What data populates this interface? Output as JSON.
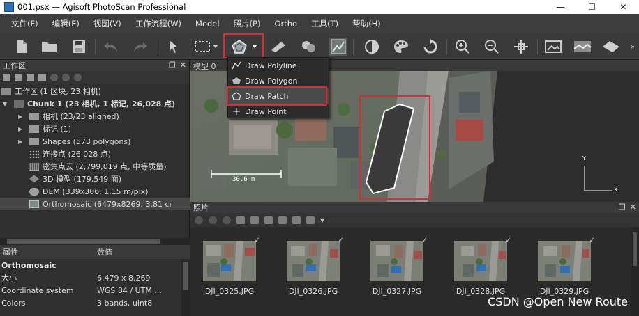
{
  "window": {
    "title": "001.psx — Agisoft PhotoScan Professional",
    "controls": [
      "—",
      "☐",
      "✕"
    ]
  },
  "menu": [
    "文件(F)",
    "编辑(E)",
    "视图(V)",
    "工作流程(W)",
    "Model",
    "照片(P)",
    "Ortho",
    "工具(T)",
    "帮助(H)"
  ],
  "toolbar": {
    "overflow": "»"
  },
  "workspace": {
    "title": "工作区",
    "root": "工作区 (1 区块, 23 相机)",
    "chunk": "Chunk 1 (23 相机, 1 标记, 26,028 点)",
    "items": [
      "相机 (23/23 aligned)",
      "标记 (1)",
      "Shapes (573 polygons)",
      "连接点 (26,028 点)",
      "密集点云 (2,799,019 点, 中等质量)",
      "3D 模型 (179,549 面)",
      "DEM (339x306, 1.15 m/pix)",
      "Orthomosaic (6479x8269, 3.81 cr"
    ]
  },
  "properties": {
    "col_key": "属性",
    "col_value": "数值",
    "section": "Orthomosaic",
    "rows": [
      {
        "k": "大小",
        "v": "6,479 x 8,269"
      },
      {
        "k": "Coordinate system",
        "v": "WGS 84 / UTM ..."
      },
      {
        "k": "Colors",
        "v": "3 bands, uint8"
      }
    ]
  },
  "model_view": {
    "tab": "模型",
    "tab_suffix": "0",
    "scale_label": "30.6 m",
    "axis_y": "Y",
    "axis_x": "X"
  },
  "dropdown": {
    "items": [
      "Draw Polyline",
      "Draw Polygon",
      "Draw Patch",
      "Draw Point"
    ]
  },
  "photos": {
    "title": "照片",
    "files": [
      "DJI_0325.JPG",
      "DJI_0326.JPG",
      "DJI_0327.JPG",
      "DJI_0328.JPG",
      "DJI_0329.JPG"
    ]
  },
  "watermark": "CSDN @Open New Route",
  "colors": {
    "highlight": "#e0282e",
    "panel": "#2f2f2f",
    "menu": "#3d3d3d"
  }
}
